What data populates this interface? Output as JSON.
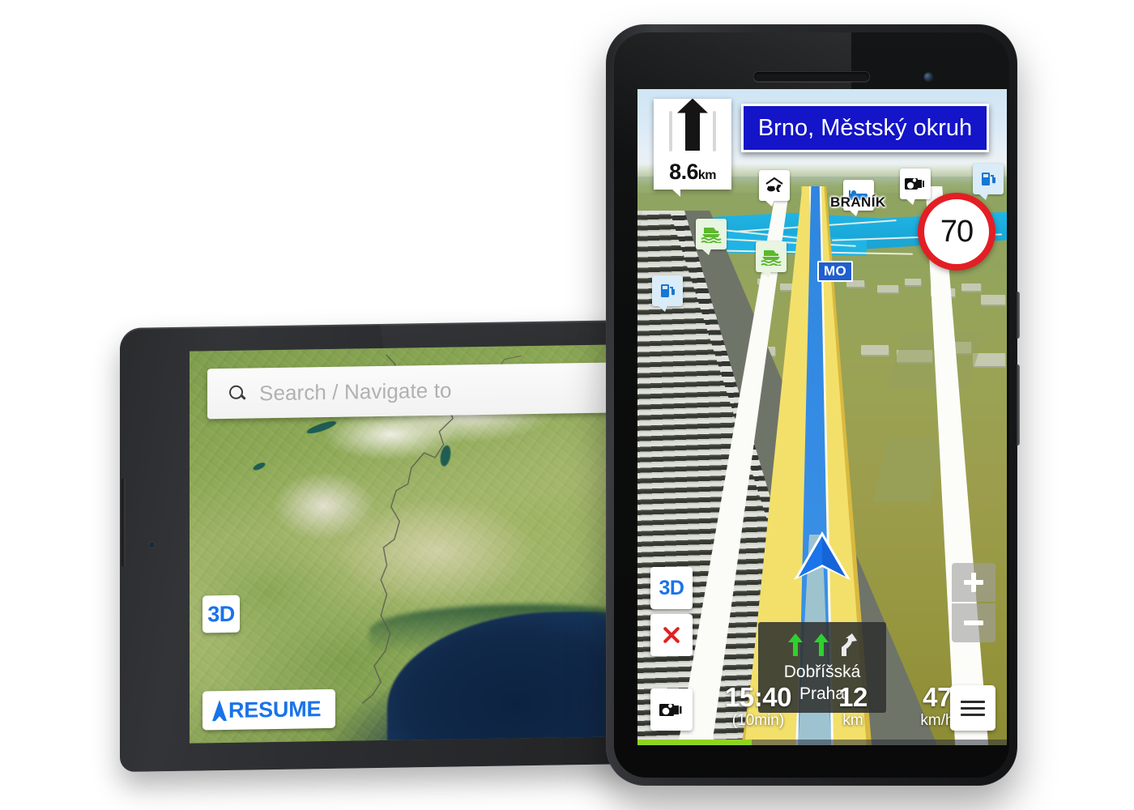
{
  "tablet": {
    "device_name": "tablet",
    "search": {
      "placeholder": "Search / Navigate to",
      "icon": "search-icon"
    },
    "buttons": {
      "view_3d": "3D",
      "resume": "RESUME",
      "resume_icon": "navigation-arrow-icon"
    }
  },
  "phone": {
    "device_name": "smartphone",
    "turn_instruction": {
      "icon": "straight-arrow-icon",
      "distance_value": "8.6",
      "distance_unit": "km"
    },
    "street_sign": {
      "text": "Brno, Městský okruh",
      "background": "#1414c8",
      "text_color": "#ffffff"
    },
    "speed_limit": {
      "value": "70",
      "ring_color": "#e31e24"
    },
    "map_labels": {
      "place": "BRANÍK",
      "road_badge": "MO"
    },
    "pois": [
      {
        "name": "car-repair-icon",
        "type": "repair"
      },
      {
        "name": "hotel-icon",
        "type": "lodging"
      },
      {
        "name": "speed-camera-icon",
        "type": "camera"
      },
      {
        "name": "fuel-icon",
        "type": "gas"
      },
      {
        "name": "fuel-icon",
        "type": "gas"
      },
      {
        "name": "car-ferry-icon",
        "type": "ferry"
      },
      {
        "name": "car-ferry-icon",
        "type": "ferry"
      }
    ],
    "buttons": {
      "view_3d": "3D",
      "close": "close-icon",
      "zoom_in": "+",
      "zoom_out": "−",
      "menu": "hamburger-menu-icon",
      "speed_camera": "speed-camera-icon"
    },
    "lane_assist": {
      "arrows": [
        "straight",
        "straight",
        "right-fork"
      ],
      "street_line1": "Dobříšská",
      "street_line2": "Praha"
    },
    "status": {
      "eta_time": "15:40",
      "eta_remaining": "(10min)",
      "distance_value": "12",
      "distance_unit": "km",
      "speed_value": "47",
      "speed_unit": "km/h"
    },
    "progress": {
      "percent": 31,
      "color": "#8fd420"
    },
    "vehicle_marker": "vehicle-position-arrow"
  }
}
